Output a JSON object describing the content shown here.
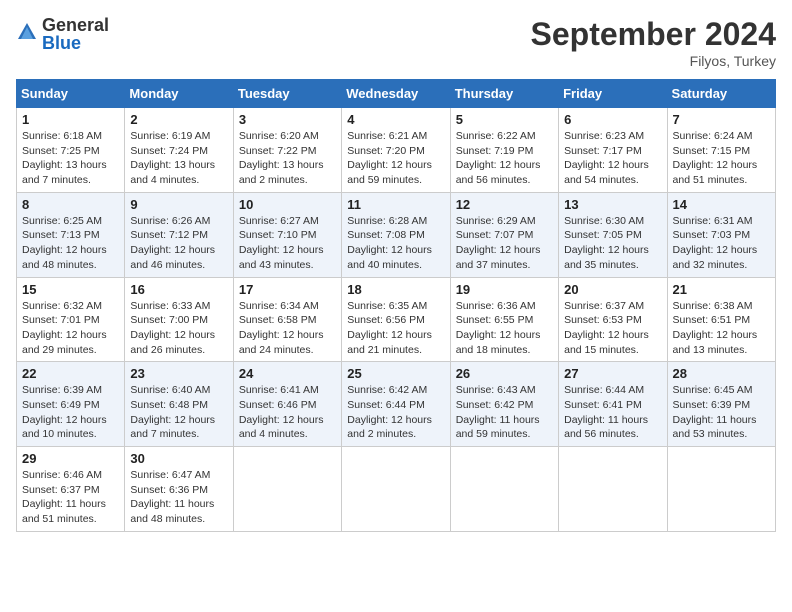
{
  "header": {
    "logo_general": "General",
    "logo_blue": "Blue",
    "month_year": "September 2024",
    "location": "Filyos, Turkey"
  },
  "columns": [
    "Sunday",
    "Monday",
    "Tuesday",
    "Wednesday",
    "Thursday",
    "Friday",
    "Saturday"
  ],
  "weeks": [
    [
      {
        "day": "1",
        "sunrise": "Sunrise: 6:18 AM",
        "sunset": "Sunset: 7:25 PM",
        "daylight": "Daylight: 13 hours and 7 minutes."
      },
      {
        "day": "2",
        "sunrise": "Sunrise: 6:19 AM",
        "sunset": "Sunset: 7:24 PM",
        "daylight": "Daylight: 13 hours and 4 minutes."
      },
      {
        "day": "3",
        "sunrise": "Sunrise: 6:20 AM",
        "sunset": "Sunset: 7:22 PM",
        "daylight": "Daylight: 13 hours and 2 minutes."
      },
      {
        "day": "4",
        "sunrise": "Sunrise: 6:21 AM",
        "sunset": "Sunset: 7:20 PM",
        "daylight": "Daylight: 12 hours and 59 minutes."
      },
      {
        "day": "5",
        "sunrise": "Sunrise: 6:22 AM",
        "sunset": "Sunset: 7:19 PM",
        "daylight": "Daylight: 12 hours and 56 minutes."
      },
      {
        "day": "6",
        "sunrise": "Sunrise: 6:23 AM",
        "sunset": "Sunset: 7:17 PM",
        "daylight": "Daylight: 12 hours and 54 minutes."
      },
      {
        "day": "7",
        "sunrise": "Sunrise: 6:24 AM",
        "sunset": "Sunset: 7:15 PM",
        "daylight": "Daylight: 12 hours and 51 minutes."
      }
    ],
    [
      {
        "day": "8",
        "sunrise": "Sunrise: 6:25 AM",
        "sunset": "Sunset: 7:13 PM",
        "daylight": "Daylight: 12 hours and 48 minutes."
      },
      {
        "day": "9",
        "sunrise": "Sunrise: 6:26 AM",
        "sunset": "Sunset: 7:12 PM",
        "daylight": "Daylight: 12 hours and 46 minutes."
      },
      {
        "day": "10",
        "sunrise": "Sunrise: 6:27 AM",
        "sunset": "Sunset: 7:10 PM",
        "daylight": "Daylight: 12 hours and 43 minutes."
      },
      {
        "day": "11",
        "sunrise": "Sunrise: 6:28 AM",
        "sunset": "Sunset: 7:08 PM",
        "daylight": "Daylight: 12 hours and 40 minutes."
      },
      {
        "day": "12",
        "sunrise": "Sunrise: 6:29 AM",
        "sunset": "Sunset: 7:07 PM",
        "daylight": "Daylight: 12 hours and 37 minutes."
      },
      {
        "day": "13",
        "sunrise": "Sunrise: 6:30 AM",
        "sunset": "Sunset: 7:05 PM",
        "daylight": "Daylight: 12 hours and 35 minutes."
      },
      {
        "day": "14",
        "sunrise": "Sunrise: 6:31 AM",
        "sunset": "Sunset: 7:03 PM",
        "daylight": "Daylight: 12 hours and 32 minutes."
      }
    ],
    [
      {
        "day": "15",
        "sunrise": "Sunrise: 6:32 AM",
        "sunset": "Sunset: 7:01 PM",
        "daylight": "Daylight: 12 hours and 29 minutes."
      },
      {
        "day": "16",
        "sunrise": "Sunrise: 6:33 AM",
        "sunset": "Sunset: 7:00 PM",
        "daylight": "Daylight: 12 hours and 26 minutes."
      },
      {
        "day": "17",
        "sunrise": "Sunrise: 6:34 AM",
        "sunset": "Sunset: 6:58 PM",
        "daylight": "Daylight: 12 hours and 24 minutes."
      },
      {
        "day": "18",
        "sunrise": "Sunrise: 6:35 AM",
        "sunset": "Sunset: 6:56 PM",
        "daylight": "Daylight: 12 hours and 21 minutes."
      },
      {
        "day": "19",
        "sunrise": "Sunrise: 6:36 AM",
        "sunset": "Sunset: 6:55 PM",
        "daylight": "Daylight: 12 hours and 18 minutes."
      },
      {
        "day": "20",
        "sunrise": "Sunrise: 6:37 AM",
        "sunset": "Sunset: 6:53 PM",
        "daylight": "Daylight: 12 hours and 15 minutes."
      },
      {
        "day": "21",
        "sunrise": "Sunrise: 6:38 AM",
        "sunset": "Sunset: 6:51 PM",
        "daylight": "Daylight: 12 hours and 13 minutes."
      }
    ],
    [
      {
        "day": "22",
        "sunrise": "Sunrise: 6:39 AM",
        "sunset": "Sunset: 6:49 PM",
        "daylight": "Daylight: 12 hours and 10 minutes."
      },
      {
        "day": "23",
        "sunrise": "Sunrise: 6:40 AM",
        "sunset": "Sunset: 6:48 PM",
        "daylight": "Daylight: 12 hours and 7 minutes."
      },
      {
        "day": "24",
        "sunrise": "Sunrise: 6:41 AM",
        "sunset": "Sunset: 6:46 PM",
        "daylight": "Daylight: 12 hours and 4 minutes."
      },
      {
        "day": "25",
        "sunrise": "Sunrise: 6:42 AM",
        "sunset": "Sunset: 6:44 PM",
        "daylight": "Daylight: 12 hours and 2 minutes."
      },
      {
        "day": "26",
        "sunrise": "Sunrise: 6:43 AM",
        "sunset": "Sunset: 6:42 PM",
        "daylight": "Daylight: 11 hours and 59 minutes."
      },
      {
        "day": "27",
        "sunrise": "Sunrise: 6:44 AM",
        "sunset": "Sunset: 6:41 PM",
        "daylight": "Daylight: 11 hours and 56 minutes."
      },
      {
        "day": "28",
        "sunrise": "Sunrise: 6:45 AM",
        "sunset": "Sunset: 6:39 PM",
        "daylight": "Daylight: 11 hours and 53 minutes."
      }
    ],
    [
      {
        "day": "29",
        "sunrise": "Sunrise: 6:46 AM",
        "sunset": "Sunset: 6:37 PM",
        "daylight": "Daylight: 11 hours and 51 minutes."
      },
      {
        "day": "30",
        "sunrise": "Sunrise: 6:47 AM",
        "sunset": "Sunset: 6:36 PM",
        "daylight": "Daylight: 11 hours and 48 minutes."
      },
      null,
      null,
      null,
      null,
      null
    ]
  ]
}
